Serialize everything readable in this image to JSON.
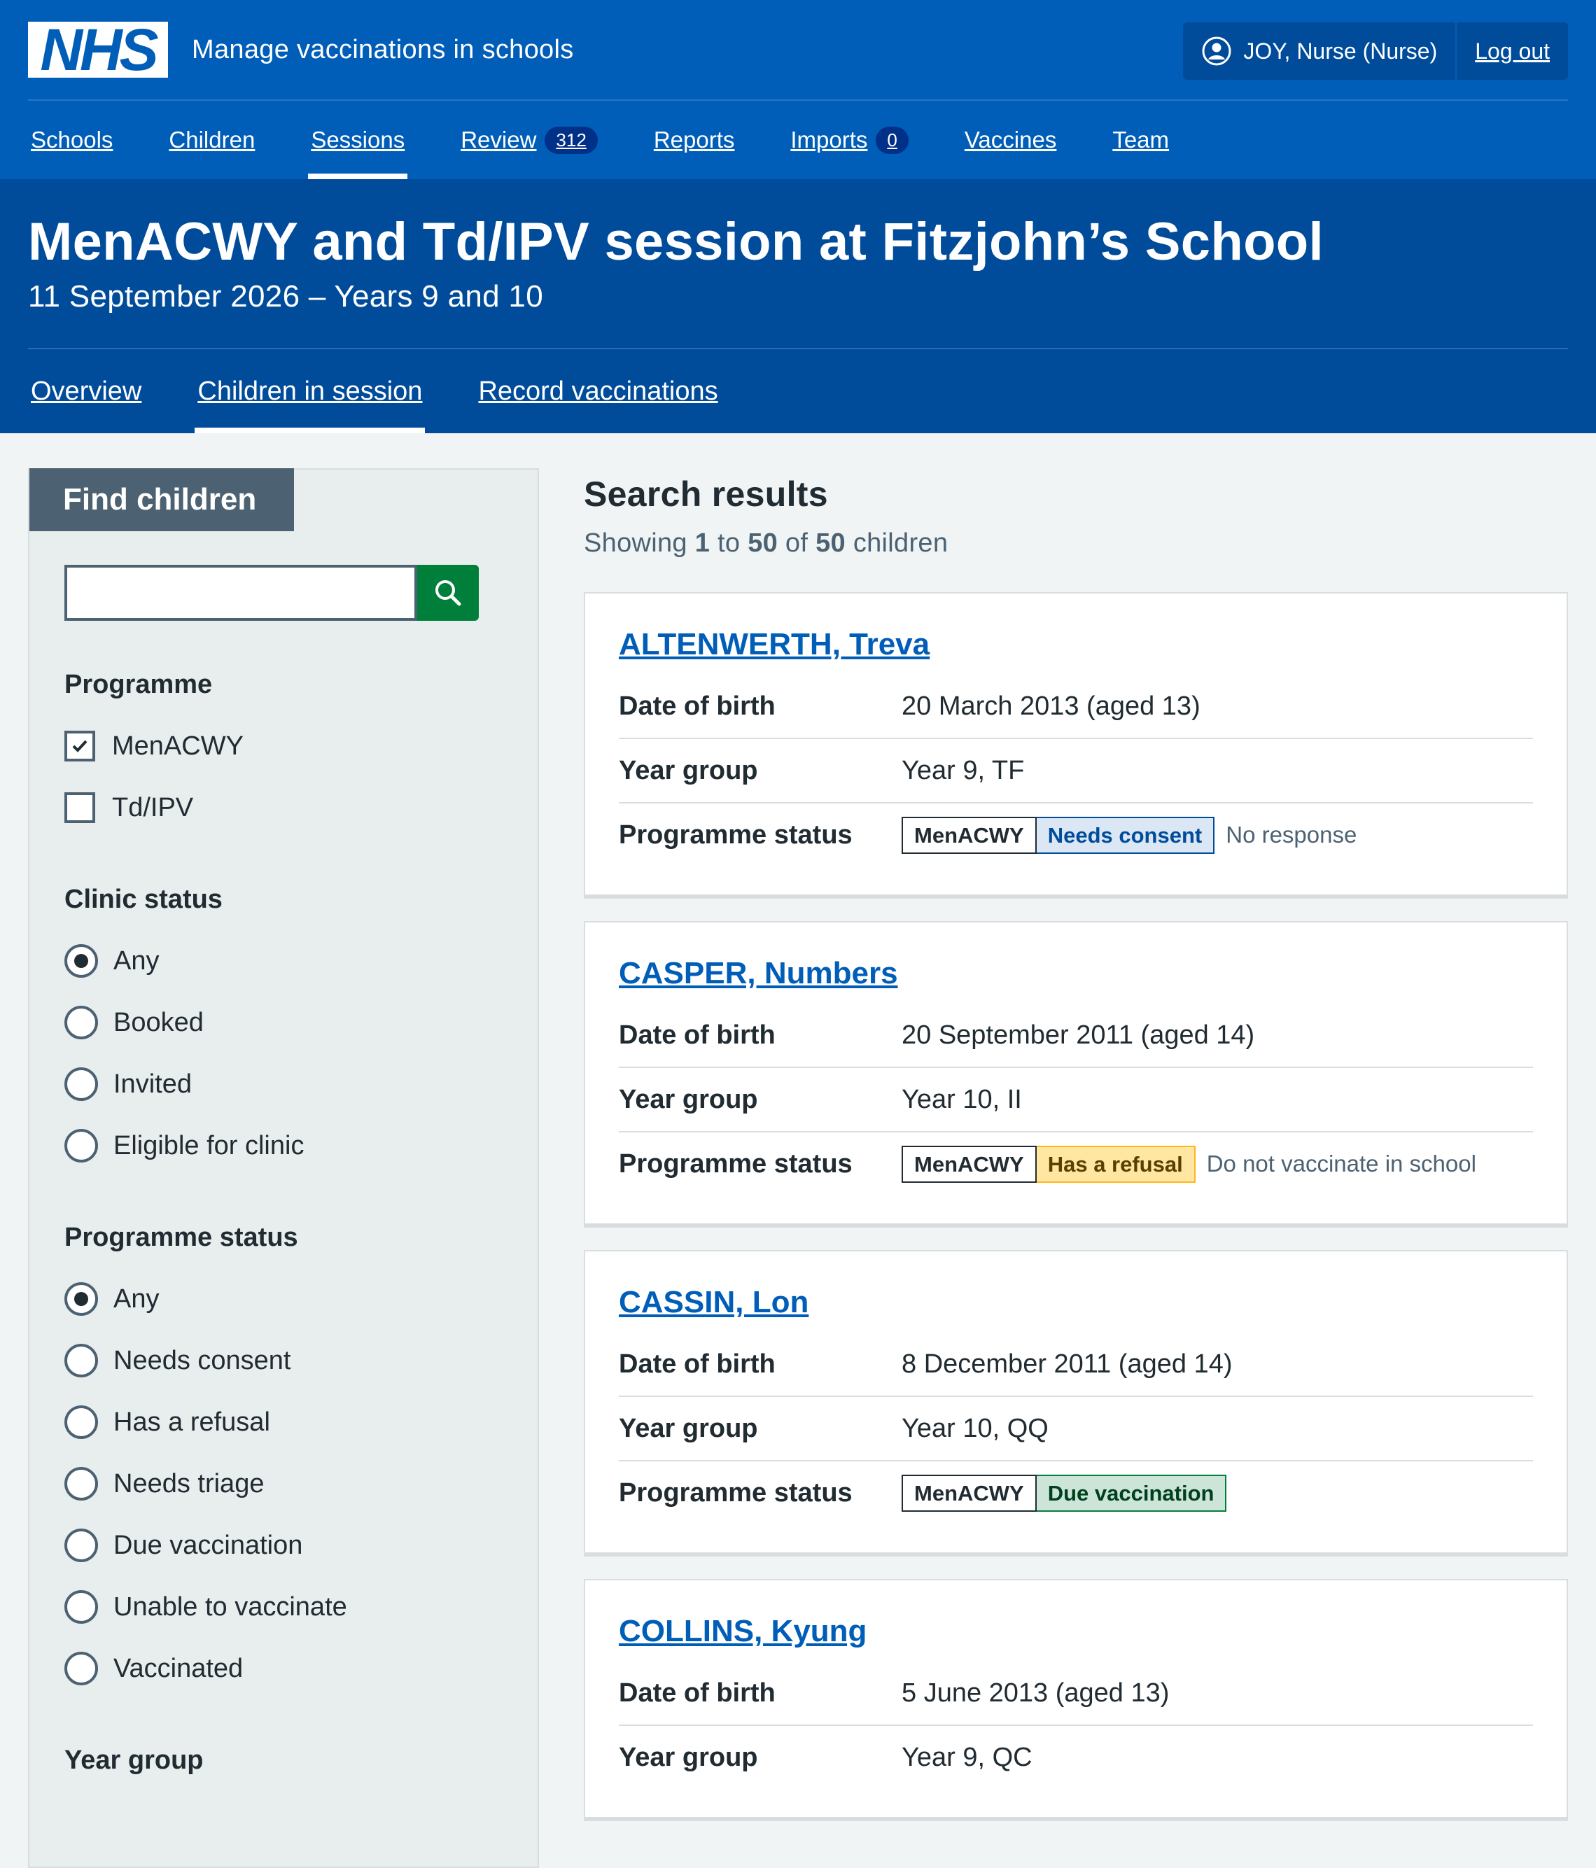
{
  "header": {
    "logo_text": "NHS",
    "service_name": "Manage vaccinations in schools",
    "account_name": "JOY, Nurse (Nurse)",
    "logout_label": "Log out",
    "icon": "user-circle-icon"
  },
  "nav": {
    "items": [
      {
        "label": "Schools"
      },
      {
        "label": "Children"
      },
      {
        "label": "Sessions",
        "active": true
      },
      {
        "label": "Review",
        "count": "312"
      },
      {
        "label": "Reports"
      },
      {
        "label": "Imports",
        "count": "0"
      },
      {
        "label": "Vaccines"
      },
      {
        "label": "Team"
      }
    ]
  },
  "session": {
    "title": "MenACWY and Td/IPV session at Fitzjohn’s School",
    "subtitle": "11 September 2026 – Years 9 and 10",
    "tabs": [
      {
        "label": "Overview"
      },
      {
        "label": "Children in session",
        "active": true
      },
      {
        "label": "Record vaccinations"
      }
    ]
  },
  "filters": {
    "heading": "Find children",
    "search": {
      "value": "",
      "placeholder": "",
      "icon": "search-icon"
    },
    "programme": {
      "legend": "Programme",
      "options": [
        {
          "label": "MenACWY",
          "checked": true
        },
        {
          "label": "Td/IPV",
          "checked": false
        }
      ]
    },
    "clinic_status": {
      "legend": "Clinic status",
      "options": [
        {
          "label": "Any",
          "selected": true
        },
        {
          "label": "Booked"
        },
        {
          "label": "Invited"
        },
        {
          "label": "Eligible for clinic"
        }
      ]
    },
    "programme_status": {
      "legend": "Programme status",
      "options": [
        {
          "label": "Any",
          "selected": true
        },
        {
          "label": "Needs consent"
        },
        {
          "label": "Has a refusal"
        },
        {
          "label": "Needs triage"
        },
        {
          "label": "Due vaccination"
        },
        {
          "label": "Unable to vaccinate"
        },
        {
          "label": "Vaccinated"
        }
      ]
    },
    "year_group": {
      "legend": "Year group"
    }
  },
  "results": {
    "title": "Search results",
    "count_prefix": "Showing",
    "count_from": "1",
    "count_to_word": "to",
    "count_to": "50",
    "count_of_word": "of",
    "count_total": "50",
    "count_suffix": "children",
    "labels": {
      "dob": "Date of birth",
      "year": "Year group",
      "status": "Programme status"
    },
    "children": [
      {
        "name": "ALTENWERTH, Treva",
        "dob": "20 March 2013 (aged 13)",
        "year": "Year 9, TF",
        "programme": "MenACWY",
        "status": "Needs consent",
        "status_color": "#005eb8",
        "note": "No response"
      },
      {
        "name": "CASPER, Numbers",
        "dob": "20 September 2011 (aged 14)",
        "year": "Year 10, II",
        "programme": "MenACWY",
        "status": "Has a refusal",
        "status_color": "#ffb81c",
        "note": "Do not vaccinate in school"
      },
      {
        "name": "CASSIN, Lon",
        "dob": "8 December 2011 (aged 14)",
        "year": "Year 10, QQ",
        "programme": "MenACWY",
        "status": "Due vaccination",
        "status_color": "#007f3b",
        "note": ""
      },
      {
        "name": "COLLINS, Kyung",
        "dob": "5 June 2013 (aged 13)",
        "year": "Year 9, QC"
      }
    ]
  },
  "colors": {
    "brand_blue": "#005eb8",
    "dark_blue": "#004c9a",
    "search_green": "#007f3b",
    "filter_heading": "#4c6272"
  }
}
